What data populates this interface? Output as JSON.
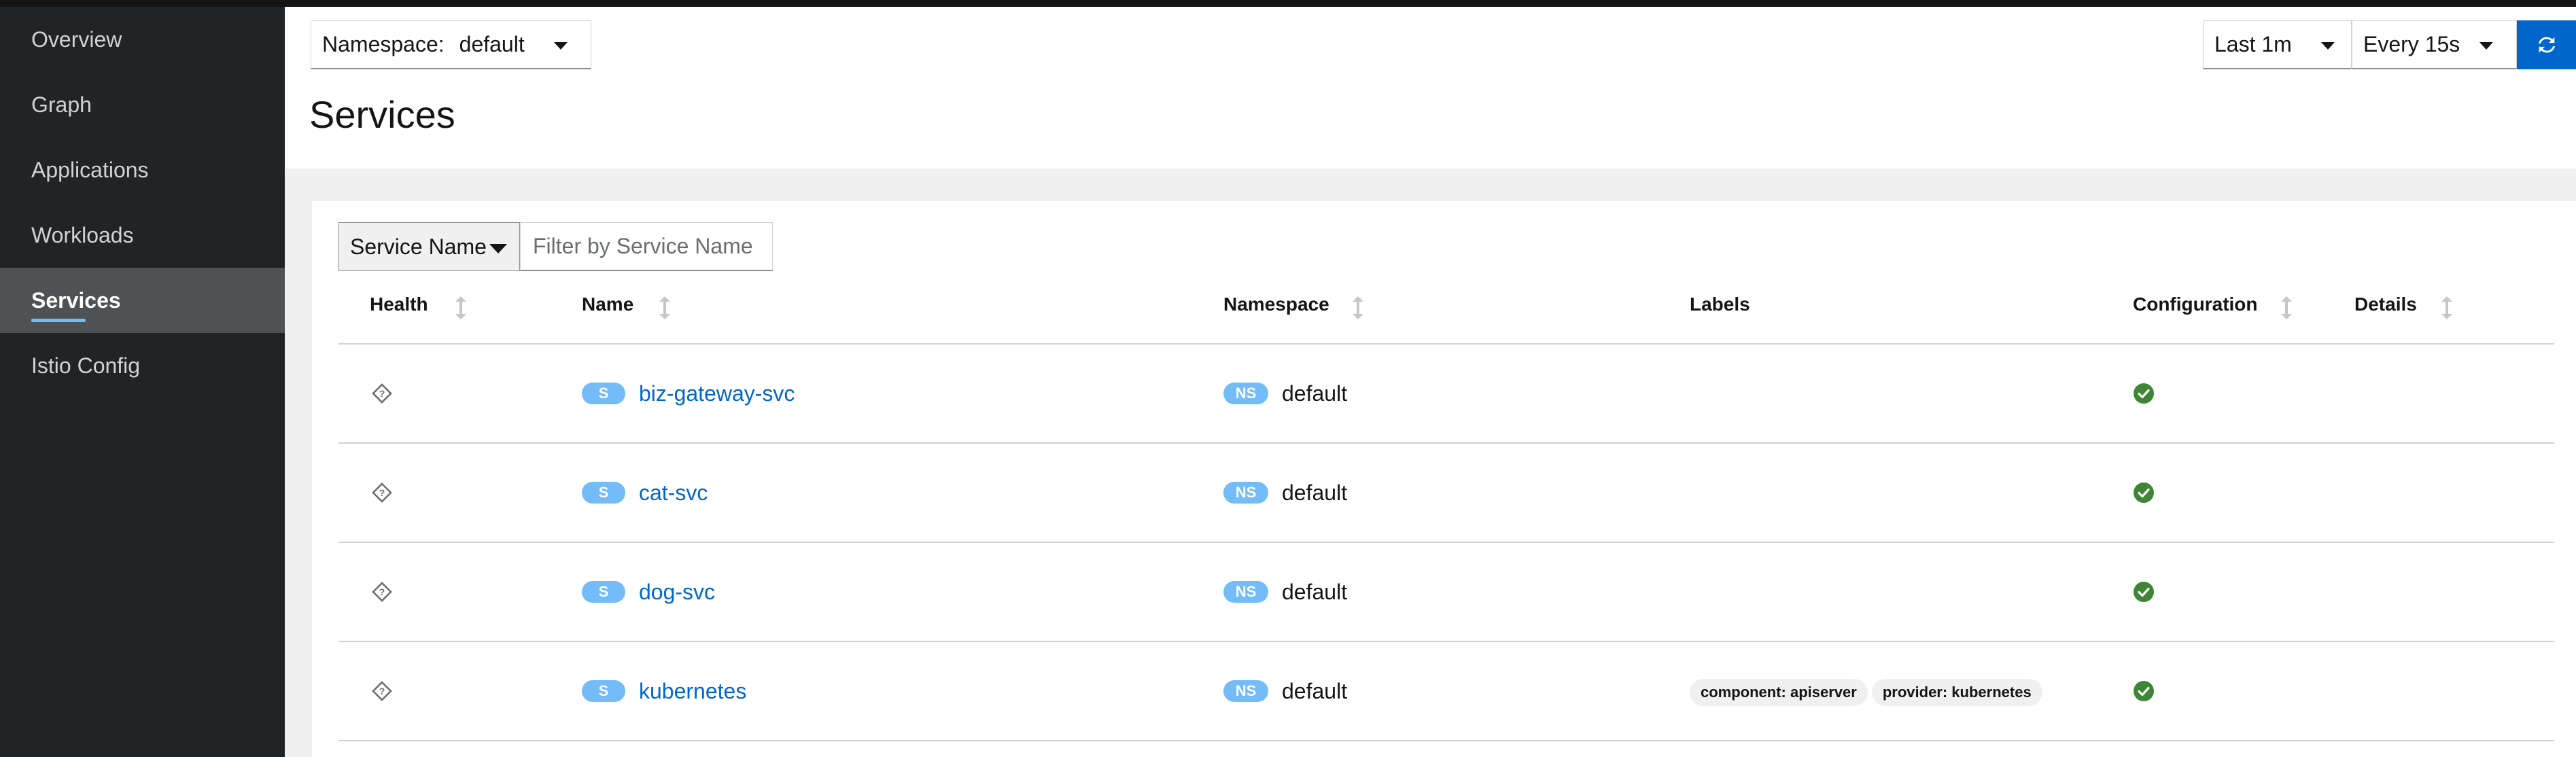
{
  "sidebar": {
    "items": [
      {
        "label": "Overview"
      },
      {
        "label": "Graph"
      },
      {
        "label": "Applications"
      },
      {
        "label": "Workloads"
      },
      {
        "label": "Services",
        "active": true
      },
      {
        "label": "Istio Config"
      }
    ]
  },
  "header": {
    "namespace_label": "Namespace:",
    "namespace_value": "default",
    "title": "Services",
    "time_range": "Last 1m",
    "refresh_interval": "Every 15s",
    "refresh_icon": "sync-icon"
  },
  "filter": {
    "type": "Service Name",
    "placeholder": "Filter by Service Name"
  },
  "table": {
    "columns": [
      "Health",
      "Name",
      "Namespace",
      "Labels",
      "Configuration",
      "Details"
    ],
    "rows": [
      {
        "health": "unknown",
        "name_badge": "S",
        "name": "biz-gateway-svc",
        "ns_badge": "NS",
        "namespace": "default",
        "labels": [],
        "config": "valid",
        "details": ""
      },
      {
        "health": "unknown",
        "name_badge": "S",
        "name": "cat-svc",
        "ns_badge": "NS",
        "namespace": "default",
        "labels": [],
        "config": "valid",
        "details": ""
      },
      {
        "health": "unknown",
        "name_badge": "S",
        "name": "dog-svc",
        "ns_badge": "NS",
        "namespace": "default",
        "labels": [],
        "config": "valid",
        "details": ""
      },
      {
        "health": "unknown",
        "name_badge": "S",
        "name": "kubernetes",
        "ns_badge": "NS",
        "namespace": "default",
        "labels": [
          "component: apiserver",
          "provider: kubernetes"
        ],
        "config": "valid",
        "details": ""
      }
    ]
  },
  "colors": {
    "sidebar_bg": "#212427",
    "active_bg": "#4f5255",
    "accent": "#0066cc",
    "badge": "#73bcf7",
    "success": "#3e8635"
  }
}
